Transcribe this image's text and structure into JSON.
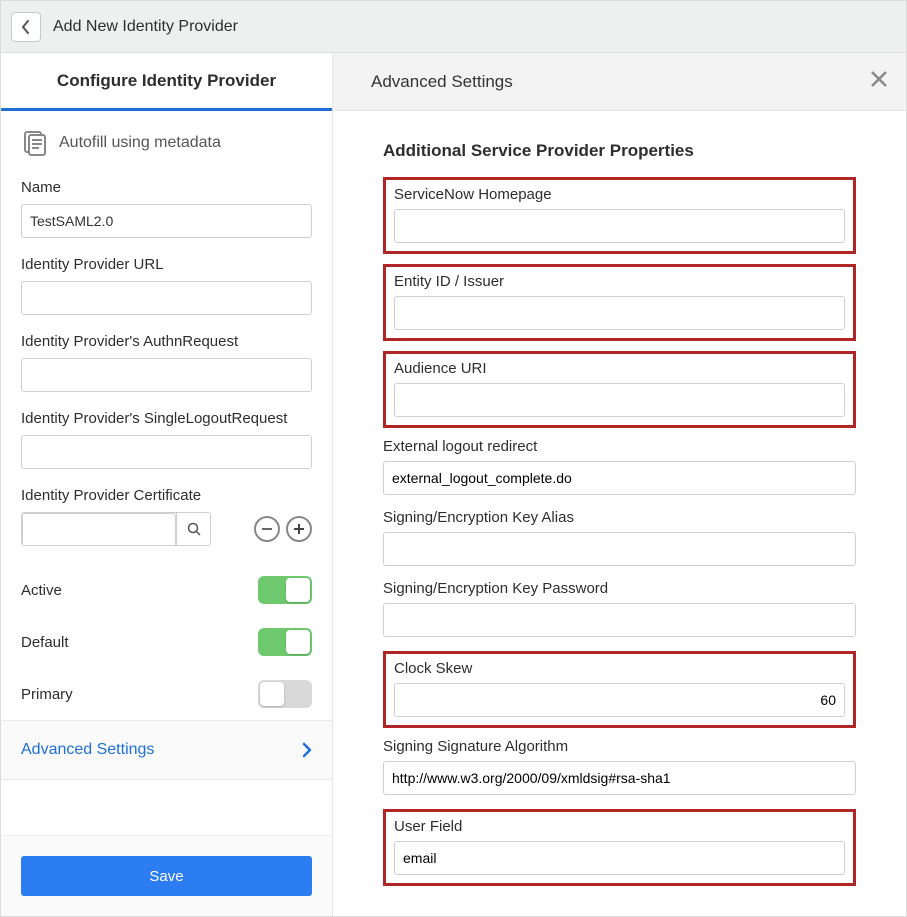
{
  "titlebar": {
    "title": "Add New Identity Provider"
  },
  "left": {
    "header": "Configure Identity Provider",
    "autofill": "Autofill using metadata",
    "fields": {
      "name": {
        "label": "Name",
        "value": "TestSAML2.0"
      },
      "idp_url": {
        "label": "Identity Provider URL",
        "value": ""
      },
      "authn": {
        "label": "Identity Provider's AuthnRequest",
        "value": ""
      },
      "slo": {
        "label": "Identity Provider's SingleLogoutRequest",
        "value": ""
      },
      "cert": {
        "label": "Identity Provider Certificate",
        "value": ""
      }
    },
    "toggles": {
      "active": {
        "label": "Active",
        "on": true
      },
      "default": {
        "label": "Default",
        "on": true
      },
      "primary": {
        "label": "Primary",
        "on": false
      }
    },
    "adv_link": "Advanced Settings",
    "save": "Save"
  },
  "right": {
    "header": "Advanced Settings",
    "section": "Additional Service Provider Properties",
    "fields": {
      "homepage": {
        "label": "ServiceNow Homepage",
        "value": "",
        "highlight": true
      },
      "entity": {
        "label": "Entity ID / Issuer",
        "value": "",
        "highlight": true
      },
      "audience": {
        "label": "Audience URI",
        "value": "",
        "highlight": true
      },
      "ext_logout": {
        "label": "External logout redirect",
        "value": "external_logout_complete.do",
        "highlight": false
      },
      "key_alias": {
        "label": "Signing/Encryption Key Alias",
        "value": "",
        "highlight": false
      },
      "key_pass": {
        "label": "Signing/Encryption Key Password",
        "value": "",
        "highlight": false
      },
      "clock": {
        "label": "Clock Skew",
        "value": "60",
        "highlight": true
      },
      "sig_alg": {
        "label": "Signing Signature Algorithm",
        "value": "http://www.w3.org/2000/09/xmldsig#rsa-sha1",
        "highlight": false
      },
      "user_field": {
        "label": "User Field",
        "value": "email",
        "highlight": true
      }
    }
  }
}
